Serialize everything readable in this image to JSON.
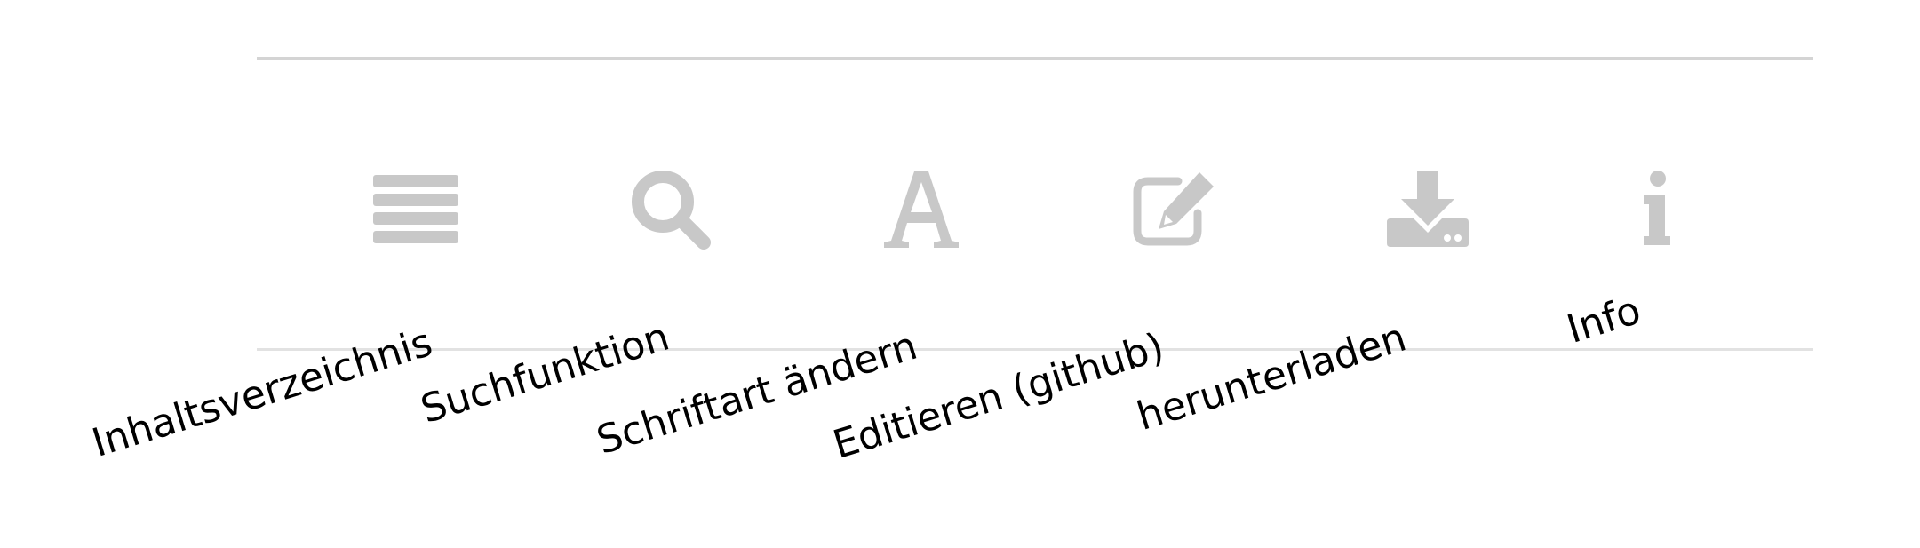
{
  "toolbar": {
    "icon_color": "#c8c8c8",
    "items": [
      {
        "icon": "list-icon",
        "label": "Inhaltsverzeichnis"
      },
      {
        "icon": "search-icon",
        "label": "Suchfunktion"
      },
      {
        "icon": "font-icon",
        "label": "Schriftart ändern"
      },
      {
        "icon": "edit-icon",
        "label": "Editieren (github)"
      },
      {
        "icon": "download-icon",
        "label": "herunterladen"
      },
      {
        "icon": "info-icon",
        "label": "Info"
      }
    ]
  }
}
